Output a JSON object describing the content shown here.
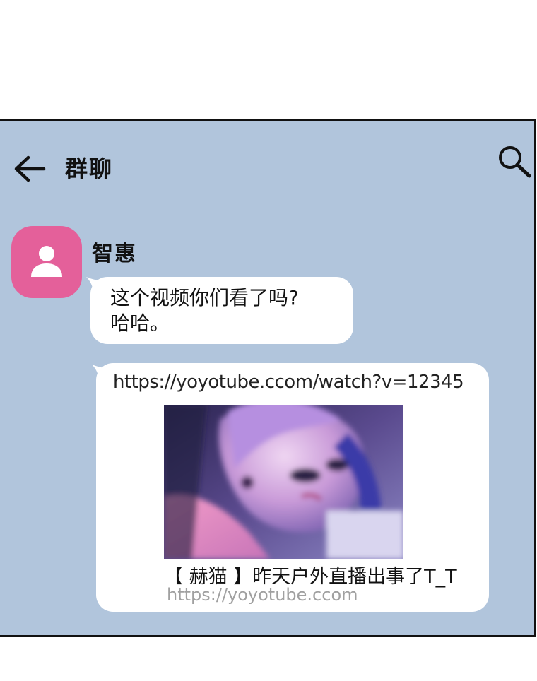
{
  "header": {
    "title": "群聊",
    "back_icon": "arrow-left-icon",
    "search_icon": "search-icon"
  },
  "message_group": {
    "sender_name": "智惠",
    "avatar_icon": "person-icon",
    "avatar_color": "#e4609a",
    "messages": [
      {
        "text_line1": "这个视频你们看了吗?",
        "text_line2": "哈哈。"
      }
    ],
    "link_message": {
      "url": "https://yoyotube.ccom/watch?v=12345",
      "preview_title": "【 赫猫 】昨天户外直播出事了T_T",
      "preview_domain": "https://yoyotube.ccom"
    }
  },
  "colors": {
    "chat_background": "#b1c5dc",
    "bubble": "#ffffff"
  }
}
